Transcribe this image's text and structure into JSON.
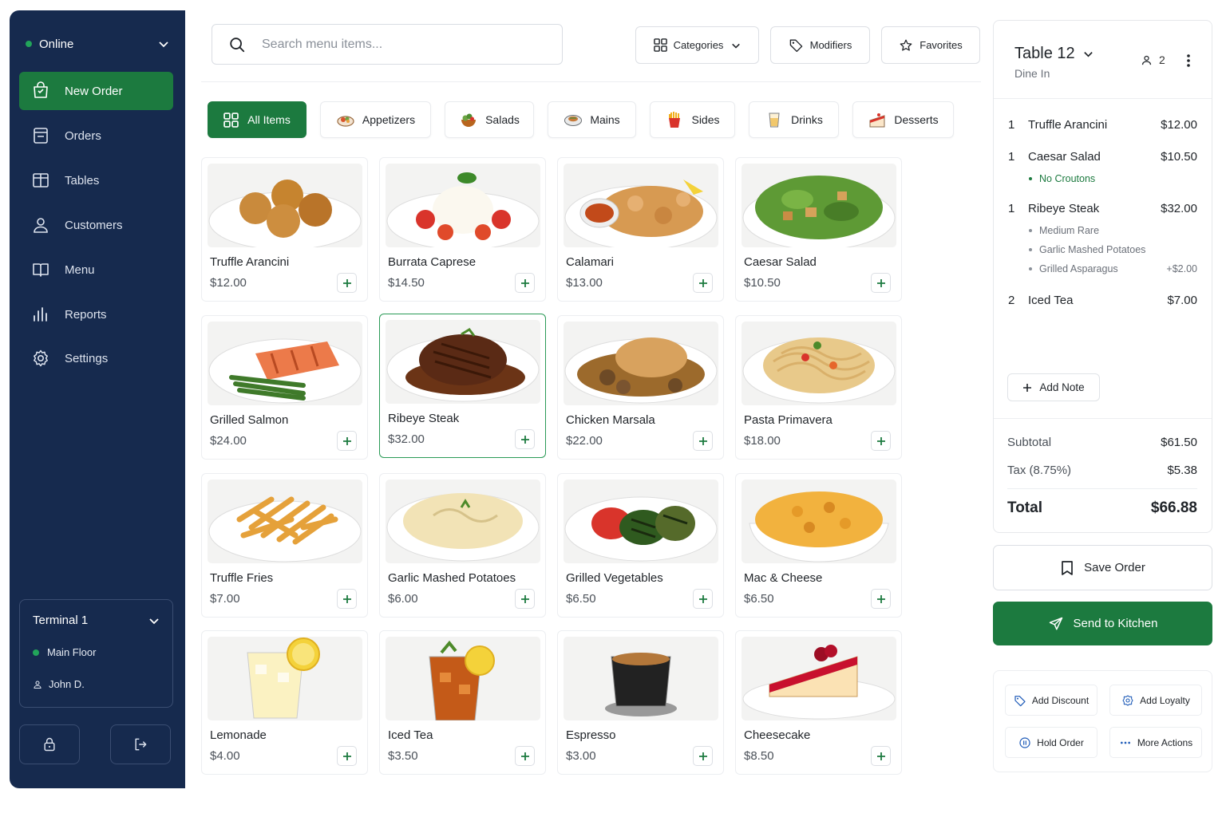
{
  "colors": {
    "sidebar": "#162a4e",
    "accent": "#1c7a3f",
    "status_online": "#22a45a"
  },
  "sidebar": {
    "status": "Online",
    "items": [
      {
        "label": "New Order",
        "icon": "shopping-bag-icon",
        "active": true
      },
      {
        "label": "Orders",
        "icon": "receipt-icon"
      },
      {
        "label": "Tables",
        "icon": "table-icon"
      },
      {
        "label": "Customers",
        "icon": "user-icon"
      },
      {
        "label": "Menu",
        "icon": "book-icon"
      },
      {
        "label": "Reports",
        "icon": "bar-chart-icon"
      },
      {
        "label": "Settings",
        "icon": "gear-icon"
      }
    ],
    "terminal": {
      "name": "Terminal 1",
      "location": "Main Floor",
      "user": "John D."
    }
  },
  "header": {
    "search_placeholder": "Search menu items...",
    "buttons": {
      "categories": "Categories",
      "modifiers": "Modifiers",
      "favorites": "Favorites"
    }
  },
  "categories": [
    {
      "label": "All Items",
      "active": true
    },
    {
      "label": "Appetizers"
    },
    {
      "label": "Salads"
    },
    {
      "label": "Mains"
    },
    {
      "label": "Sides"
    },
    {
      "label": "Drinks"
    },
    {
      "label": "Desserts"
    }
  ],
  "menu_items": [
    {
      "name": "Truffle Arancini",
      "price": "$12.00"
    },
    {
      "name": "Burrata Caprese",
      "price": "$14.50"
    },
    {
      "name": "Calamari",
      "price": "$13.00"
    },
    {
      "name": "Caesar Salad",
      "price": "$10.50"
    },
    {
      "name": "Grilled Salmon",
      "price": "$24.00"
    },
    {
      "name": "Ribeye Steak",
      "price": "$32.00",
      "selected": true
    },
    {
      "name": "Chicken Marsala",
      "price": "$22.00"
    },
    {
      "name": "Pasta Primavera",
      "price": "$18.00"
    },
    {
      "name": "Truffle Fries",
      "price": "$7.00"
    },
    {
      "name": "Garlic Mashed Potatoes",
      "price": "$6.00"
    },
    {
      "name": "Grilled Vegetables",
      "price": "$6.50"
    },
    {
      "name": "Mac & Cheese",
      "price": "$6.50"
    },
    {
      "name": "Lemonade",
      "price": "$4.00"
    },
    {
      "name": "Iced Tea",
      "price": "$3.50"
    },
    {
      "name": "Espresso",
      "price": "$3.00"
    },
    {
      "name": "Cheesecake",
      "price": "$8.50"
    }
  ],
  "order": {
    "table": "Table 12",
    "service": "Dine In",
    "guests": "2",
    "lines": [
      {
        "qty": "1",
        "name": "Truffle Arancini",
        "price": "$12.00"
      },
      {
        "qty": "1",
        "name": "Caesar Salad",
        "price": "$10.50",
        "mods": [
          {
            "label": "No Croutons"
          }
        ]
      },
      {
        "qty": "1",
        "name": "Ribeye Steak",
        "price": "$32.00",
        "mods": [
          {
            "label": "Medium Rare"
          },
          {
            "label": "Garlic Mashed Potatoes"
          },
          {
            "label": "Grilled Asparagus",
            "price": "+$2.00"
          }
        ]
      },
      {
        "qty": "2",
        "name": "Iced Tea",
        "price": "$7.00"
      }
    ],
    "add_note": "Add Note",
    "subtotal_label": "Subtotal",
    "subtotal": "$61.50",
    "tax_label": "Tax (8.75%)",
    "tax": "$5.38",
    "total_label": "Total",
    "total": "$66.88"
  },
  "buttons": {
    "save_order": "Save Order",
    "send_to_kitchen": "Send to Kitchen",
    "add_discount": "Add Discount",
    "add_loyalty": "Add Loyalty",
    "hold_order": "Hold Order",
    "more_actions": "More Actions"
  }
}
